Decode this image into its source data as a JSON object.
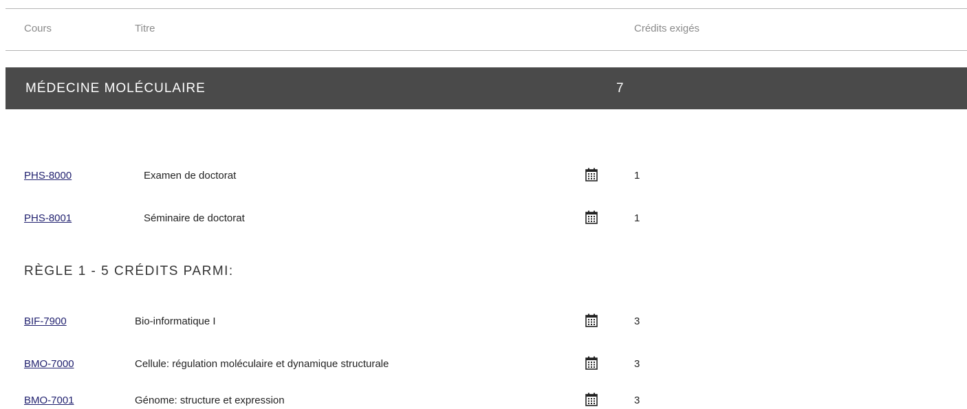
{
  "header": {
    "col_course": "Cours",
    "col_title": "Titre",
    "col_credits": "Crédits exigés"
  },
  "section": {
    "title": "MÉDECINE MOLÉCULAIRE",
    "credits": "7"
  },
  "required_courses": [
    {
      "code": "PHS-8000",
      "title": "Examen de doctorat",
      "credits": "1",
      "icon": "calendar-icon"
    },
    {
      "code": "PHS-8001",
      "title": "Séminaire de doctorat",
      "credits": "1",
      "icon": "calendar-icon"
    }
  ],
  "rule1": {
    "heading": "RÈGLE 1 - 5 CRÉDITS PARMI:",
    "courses": [
      {
        "code": "BIF-7900",
        "title": "Bio-informatique I",
        "credits": "3",
        "icon": "calendar-icon"
      },
      {
        "code": "BMO-7000",
        "title": "Cellule: régulation moléculaire et dynamique structurale",
        "credits": "3",
        "icon": "calendar-icon"
      },
      {
        "code": "BMO-7001",
        "title": "Génome: structure et expression",
        "credits": "3",
        "icon": "calendar-icon"
      }
    ]
  },
  "colors": {
    "section_bar": "#4a4a4a",
    "link": "#1f1f6e",
    "header_text": "#8a8a8a"
  }
}
